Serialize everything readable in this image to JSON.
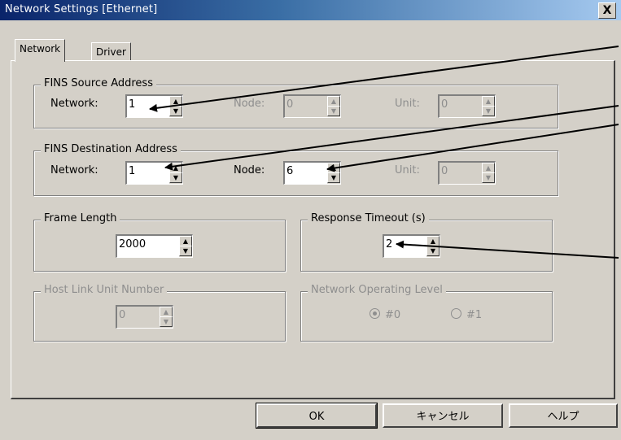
{
  "window": {
    "title": "Network Settings [Ethernet]",
    "close_glyph": "X"
  },
  "tabs": [
    {
      "label": "Network",
      "active": true
    },
    {
      "label": "Driver",
      "active": false
    }
  ],
  "fins_source": {
    "group_label": "FINS Source Address",
    "network_label": "Network:",
    "network_value": "1",
    "node_label": "Node:",
    "node_value": "0",
    "unit_label": "Unit:",
    "unit_value": "0"
  },
  "fins_destination": {
    "group_label": "FINS Destination Address",
    "network_label": "Network:",
    "network_value": "1",
    "node_label": "Node:",
    "node_value": "6",
    "unit_label": "Unit:",
    "unit_value": "0"
  },
  "frame_length": {
    "group_label": "Frame Length",
    "value": "2000"
  },
  "response_timeout": {
    "group_label": "Response Timeout (s)",
    "value": "2"
  },
  "host_link": {
    "group_label": "Host Link Unit Number",
    "value": "0"
  },
  "network_operating_level": {
    "group_label": "Network Operating Level",
    "options": [
      {
        "label": "#0",
        "checked": true
      },
      {
        "label": "#1",
        "checked": false
      }
    ]
  },
  "buttons": {
    "ok": "OK",
    "cancel": "キャンセル",
    "help": "ヘルプ"
  },
  "spin_glyphs": {
    "up": "▲",
    "down": "▼"
  },
  "colors": {
    "face": "#d4d0c8",
    "title_start": "#0a246a",
    "title_end": "#a6caf0",
    "disabled_text": "#8e8e8e"
  }
}
